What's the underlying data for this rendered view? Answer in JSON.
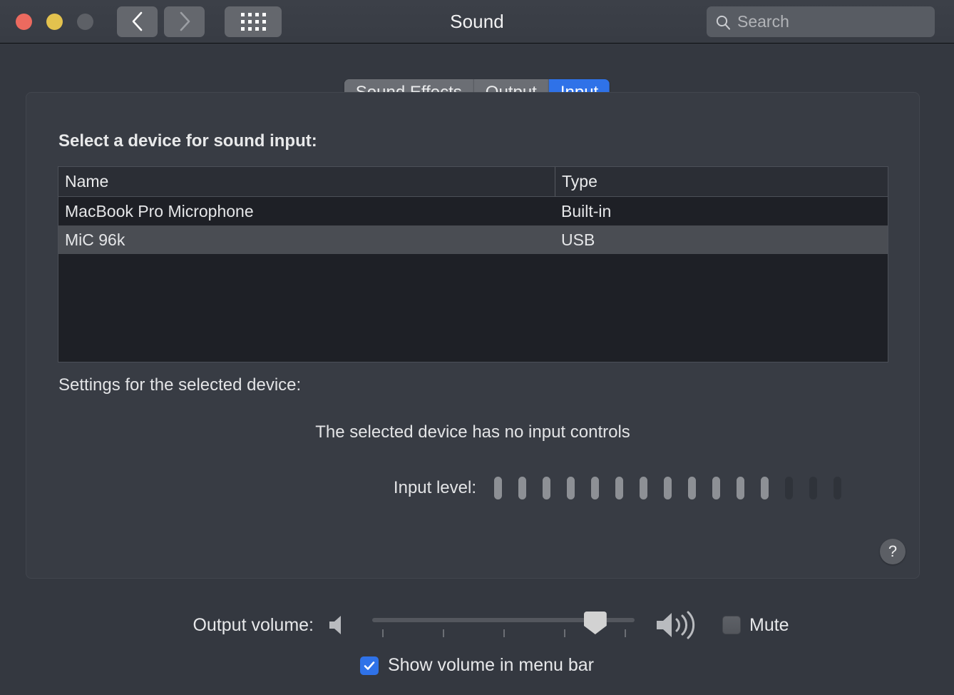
{
  "window": {
    "title": "Sound",
    "traffic_lights": [
      "close",
      "minimize",
      "zoom-disabled"
    ],
    "nav": {
      "back": "back-chevron",
      "forward": "forward-chevron",
      "grid": "show-all-grid"
    }
  },
  "search": {
    "placeholder": "Search",
    "value": "",
    "icon": "search-icon"
  },
  "tabs": [
    {
      "label": "Sound Effects",
      "selected": false
    },
    {
      "label": "Output",
      "selected": false
    },
    {
      "label": "Input",
      "selected": true
    }
  ],
  "panel": {
    "device_prompt": "Select a device for sound input:",
    "table": {
      "columns": [
        "Name",
        "Type"
      ],
      "rows": [
        {
          "name": "MacBook Pro Microphone",
          "type": "Built-in",
          "selected": false
        },
        {
          "name": "MiC 96k",
          "type": "USB",
          "selected": true
        }
      ]
    },
    "settings_label": "Settings for the selected device:",
    "no_controls_message": "The selected device has no input controls",
    "input_level": {
      "label": "Input level:",
      "segments_total": 15,
      "segments_lit": 12
    },
    "help_button": "?"
  },
  "footer": {
    "volume_label": "Output volume:",
    "speaker_min_icon": "speaker-muted-icon",
    "speaker_max_icon": "speaker-loud-icon",
    "slider": {
      "value_percent": 85,
      "tick_count": 5
    },
    "mute": {
      "label": "Mute",
      "checked": false
    },
    "menu_bar": {
      "label": "Show volume in menu bar",
      "checked": true
    }
  },
  "colors": {
    "accent": "#2f72e8",
    "window_bg": "#343840",
    "panel_bg": "#383c44",
    "table_bg": "#1e2026",
    "selected_row": "#4a4d53",
    "meter_on": "#8d9095",
    "meter_off": "#2f333a"
  }
}
